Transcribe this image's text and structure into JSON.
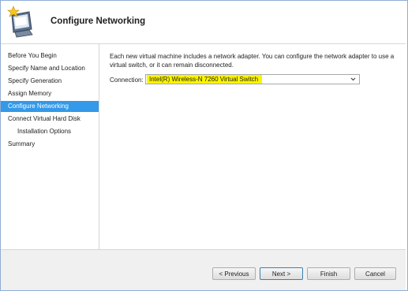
{
  "header": {
    "title": "Configure Networking",
    "icon": "wizard-computer-star-icon"
  },
  "sidebar": {
    "items": [
      {
        "label": "Before You Begin"
      },
      {
        "label": "Specify Name and Location"
      },
      {
        "label": "Specify Generation"
      },
      {
        "label": "Assign Memory"
      },
      {
        "label": "Configure Networking",
        "active": true
      },
      {
        "label": "Connect Virtual Hard Disk"
      },
      {
        "label": "Installation Options",
        "indent": true
      },
      {
        "label": "Summary"
      }
    ]
  },
  "main": {
    "description": "Each new virtual machine includes a network adapter. You can configure the network adapter to use a virtual switch, or it can remain disconnected.",
    "connection_label": "Connection:",
    "connection_value": "Intel(R) Wireless-N 7260 Virtual Switch",
    "highlight_color": "#fbf400"
  },
  "footer": {
    "previous_label": "< Previous",
    "next_label": "Next >",
    "finish_label": "Finish",
    "cancel_label": "Cancel"
  },
  "colors": {
    "accent": "#3399e8",
    "frame_border": "#8eaed4"
  }
}
